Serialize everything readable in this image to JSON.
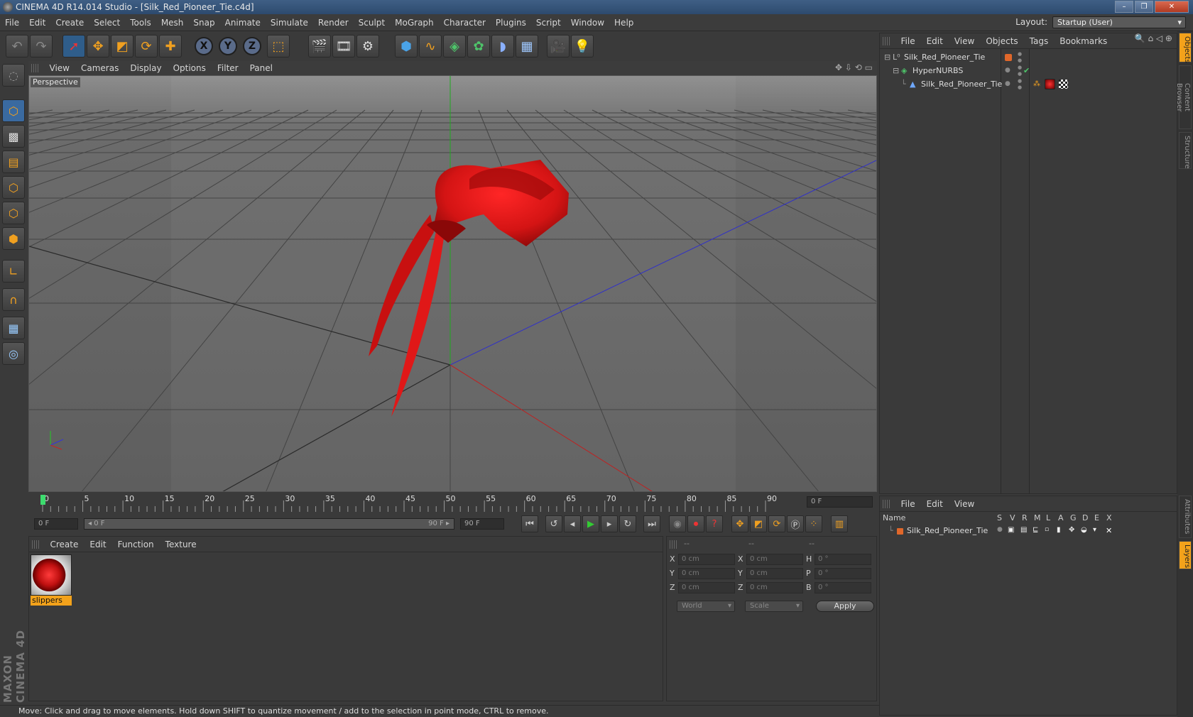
{
  "window": {
    "title": "CINEMA 4D R14.014 Studio - [Silk_Red_Pioneer_Tie.c4d]",
    "buttons": [
      "–",
      "❐",
      "✕"
    ]
  },
  "menubar": {
    "items": [
      "File",
      "Edit",
      "Create",
      "Select",
      "Tools",
      "Mesh",
      "Snap",
      "Animate",
      "Simulate",
      "Render",
      "Sculpt",
      "MoGraph",
      "Character",
      "Plugins",
      "Script",
      "Window",
      "Help"
    ],
    "layout_label": "Layout:",
    "layout_value": "Startup (User)"
  },
  "toolbar": {
    "icons": [
      "undo-icon",
      "redo-icon",
      "live-selection-icon",
      "move-icon",
      "scale-icon",
      "rotate-icon",
      "add-icon",
      "x-axis-icon",
      "y-axis-icon",
      "z-axis-icon",
      "coordinate-system-icon",
      "render-view-icon",
      "render-picture-viewer-icon",
      "render-settings-icon",
      "cube-icon",
      "spline-icon",
      "nurbs-icon",
      "array-icon",
      "deformer-icon",
      "floor-icon",
      "camera-icon",
      "light-icon"
    ],
    "axis_x": "X",
    "axis_y": "Y",
    "axis_z": "Z"
  },
  "viewport": {
    "menu": [
      "View",
      "Cameras",
      "Display",
      "Options",
      "Filter",
      "Panel"
    ],
    "label": "Perspective",
    "colors": {
      "bg_top": "#5e5e5e",
      "bg_bottom": "#6e6e6e",
      "object": "#d41414"
    }
  },
  "timeline": {
    "ticks": [
      "0",
      "5",
      "10",
      "15",
      "20",
      "25",
      "30",
      "35",
      "40",
      "45",
      "50",
      "55",
      "60",
      "65",
      "70",
      "75",
      "80",
      "85",
      "90"
    ],
    "current_frame": "0 F"
  },
  "transport": {
    "start_field": "0 F",
    "range_start": "◂ 0 F",
    "range_end": "90 F ▸",
    "end_field": "90 F"
  },
  "materials": {
    "menu": [
      "Create",
      "Edit",
      "Function",
      "Texture"
    ],
    "items": [
      {
        "name": "slippers"
      }
    ]
  },
  "coordinates": {
    "headers": [
      "--",
      "--",
      "--"
    ],
    "rows": [
      {
        "a_label": "X",
        "a_value": "0 cm",
        "b_label": "X",
        "b_value": "0 cm",
        "c_label": "H",
        "c_value": "0 °"
      },
      {
        "a_label": "Y",
        "a_value": "0 cm",
        "b_label": "Y",
        "b_value": "0 cm",
        "c_label": "P",
        "c_value": "0 °"
      },
      {
        "a_label": "Z",
        "a_value": "0 cm",
        "b_label": "Z",
        "b_value": "0 cm",
        "c_label": "B",
        "c_value": "0 °"
      }
    ],
    "mode": "World",
    "scale": "Scale",
    "apply": "Apply"
  },
  "objects": {
    "menu": [
      "File",
      "Edit",
      "View",
      "Objects",
      "Tags",
      "Bookmarks"
    ],
    "tree": [
      {
        "name": "Silk_Red_Pioneer_Tie",
        "indent": 0,
        "icon": "null-icon"
      },
      {
        "name": "HyperNURBS",
        "indent": 1,
        "icon": "hypernurbs-icon"
      },
      {
        "name": "Silk_Red_Pioneer_Tie",
        "indent": 2,
        "icon": "polygon-icon"
      }
    ]
  },
  "layers": {
    "menu": [
      "File",
      "Edit",
      "View"
    ],
    "columns": [
      "Name",
      "S",
      "V",
      "R",
      "M",
      "L",
      "A",
      "G",
      "D",
      "E",
      "X"
    ],
    "rows": [
      {
        "name": "Silk_Red_Pioneer_Tie"
      }
    ]
  },
  "right_tabs": [
    "Objects",
    "Content Browser",
    "Structure",
    "Attributes",
    "Layers"
  ],
  "left_brand": "MAXON CINEMA 4D",
  "status": "Move: Click and drag to move elements. Hold down SHIFT to quantize movement / add to the selection in point mode, CTRL to remove."
}
